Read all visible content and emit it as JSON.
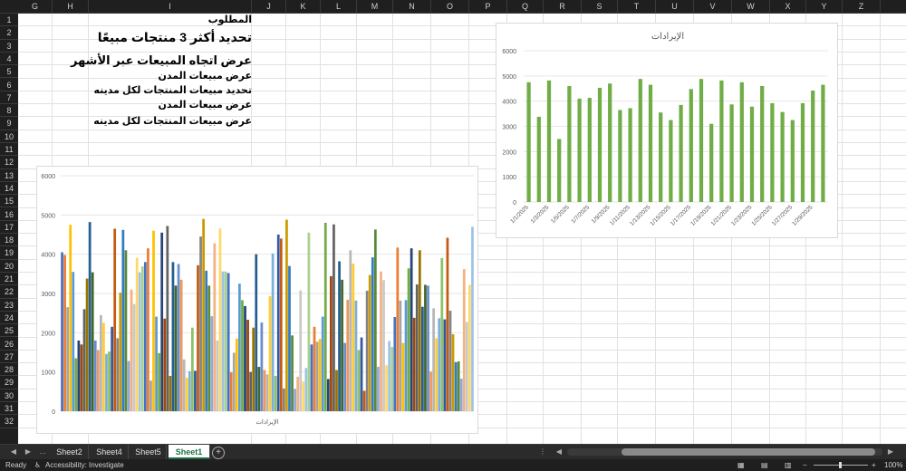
{
  "columns": [
    "G",
    "H",
    "I",
    "J",
    "K",
    "L",
    "M",
    "N",
    "O",
    "P",
    "Q",
    "R",
    "S",
    "T",
    "U",
    "V",
    "W",
    "X",
    "Y",
    "Z"
  ],
  "rows": [
    "1",
    "2",
    "3",
    "4",
    "5",
    "6",
    "7",
    "8",
    "9",
    "10",
    "11",
    "12",
    "13",
    "14",
    "15",
    "16",
    "17",
    "18",
    "19",
    "20",
    "21",
    "22",
    "23",
    "24",
    "25",
    "26",
    "27",
    "28",
    "29",
    "30",
    "31",
    "32"
  ],
  "cells": [
    {
      "text": "المطلوب",
      "size": 11
    },
    {
      "text": "تحديد أكثر 3 منتجات مبيعًا",
      "size": 14
    },
    {
      "text": "عرض اتجاه المبيعات عبر الأشهر",
      "size": 13
    },
    {
      "text": "عرض مبيعات المدن",
      "size": 11
    },
    {
      "text": "تحديد مبيعات المنتجات لكل مدينه",
      "size": 11
    },
    {
      "text": "عرض مبيعات المدن",
      "size": 11
    },
    {
      "text": "عرض مبيعات المنتجات لكل مدينه",
      "size": 11
    }
  ],
  "chart_data": [
    {
      "type": "bar",
      "title": "الإيرادات",
      "ylim": [
        0,
        6000
      ],
      "yticks": [
        "0",
        "1000",
        "2000",
        "3000",
        "4000",
        "5000",
        "6000"
      ],
      "categories": [
        "1/1/2025",
        "1/2/2025",
        "1/3/2025",
        "1/4/2025",
        "1/5/2025",
        "1/6/2025",
        "1/7/2025",
        "1/8/2025",
        "1/9/2025",
        "1/10/2025",
        "1/11/2025",
        "1/12/2025",
        "1/13/2025",
        "1/14/2025",
        "1/15/2025",
        "1/16/2025",
        "1/17/2025",
        "1/18/2025",
        "1/19/2025",
        "1/20/2025",
        "1/21/2025",
        "1/22/2025",
        "1/23/2025",
        "1/24/2025",
        "1/25/2025",
        "1/26/2025",
        "1/27/2025",
        "1/28/2025",
        "1/29/2025",
        "1/30/2025"
      ],
      "xticks": [
        "1/1/2025",
        "1/3/2025",
        "1/5/2025",
        "1/7/2025",
        "1/9/2025",
        "1/11/2025",
        "1/13/2025",
        "1/15/2025",
        "1/17/2025",
        "1/19/2025",
        "1/21/2025",
        "1/23/2025",
        "1/25/2025",
        "1/27/2025",
        "1/29/2025"
      ],
      "values": [
        4750,
        3380,
        4820,
        2500,
        4600,
        4100,
        4130,
        4530,
        4700,
        3650,
        3720,
        4880,
        4650,
        3550,
        3250,
        3850,
        4480,
        4880,
        3100,
        4820,
        3870,
        4750,
        3780,
        4600,
        3920,
        3570,
        3250,
        3920,
        4420,
        4650
      ],
      "color": "#70ad47"
    },
    {
      "type": "bar",
      "title": "",
      "xlabel": "الإيرادات",
      "ylim": [
        0,
        6000
      ],
      "yticks": [
        "0",
        "1000",
        "2000",
        "3000",
        "4000",
        "5000",
        "6000"
      ],
      "values": [
        4050,
        3980,
        2650,
        4750,
        3550,
        1350,
        1800,
        1700,
        2600,
        3380,
        4820,
        3540,
        1800,
        1560,
        2450,
        2250,
        1460,
        1520,
        2150,
        4650,
        1860,
        3020,
        4620,
        4100,
        1280,
        3100,
        2730,
        3910,
        3540,
        3690,
        3800,
        4150,
        780,
        4600,
        2410,
        1480,
        4550,
        2360,
        4720,
        900,
        3800,
        3200,
        3750,
        3350,
        1320,
        850,
        1020,
        2130,
        1030,
        3720,
        4450,
        4900,
        3580,
        3200,
        2420,
        4280,
        1800,
        4660,
        3560,
        3560,
        3520,
        990,
        1490,
        1850,
        3250,
        2830,
        2680,
        2330,
        1000,
        2130,
        4000,
        1130,
        2260,
        1050,
        940,
        2930,
        4020,
        900,
        4500,
        4400,
        580,
        4880,
        3700,
        1930,
        570,
        880,
        3080,
        760,
        1100,
        4550,
        1700,
        2150,
        1770,
        1840,
        2410,
        4800,
        820,
        3440,
        4760,
        1050,
        3820,
        3350,
        1740,
        2840,
        4100,
        3760,
        2820,
        1560,
        1880,
        520,
        3070,
        3470,
        3920,
        4630,
        1130,
        3560,
        3340,
        1170,
        1790,
        1640,
        2400,
        4170,
        2820,
        1740,
        2830,
        3640,
        4150,
        2380,
        3230,
        4100,
        2660,
        3220,
        3200,
        1010,
        2620,
        1860,
        2370,
        3900,
        2340,
        4420,
        2560,
        1960,
        1250,
        1270,
        830,
        3620,
        2270,
        3220,
        4700
      ],
      "colors": [
        "#4472c4",
        "#ed7d31",
        "#a5a5a5",
        "#ffc000",
        "#5b9bd5",
        "#70ad47",
        "#264478",
        "#9e480e",
        "#636363",
        "#997300",
        "#255e91",
        "#43682b",
        "#698ed0",
        "#f1975a",
        "#b7b7b7",
        "#ffcd33",
        "#7cafdd",
        "#8cc168",
        "#335aa1",
        "#c55a11",
        "#848484",
        "#cc9a00",
        "#327dc2",
        "#5a8a39",
        "#8faadc",
        "#f4b183",
        "#c9c9c9",
        "#ffd966",
        "#9dc3e6",
        "#a9d18e"
      ]
    }
  ],
  "sheets": [
    "Sheet2",
    "Sheet4",
    "Sheet5",
    "Sheet1"
  ],
  "active_sheet": "Sheet1",
  "status": {
    "ready": "Ready",
    "accessibility": "Accessibility: Investigate",
    "zoom": "100%"
  }
}
